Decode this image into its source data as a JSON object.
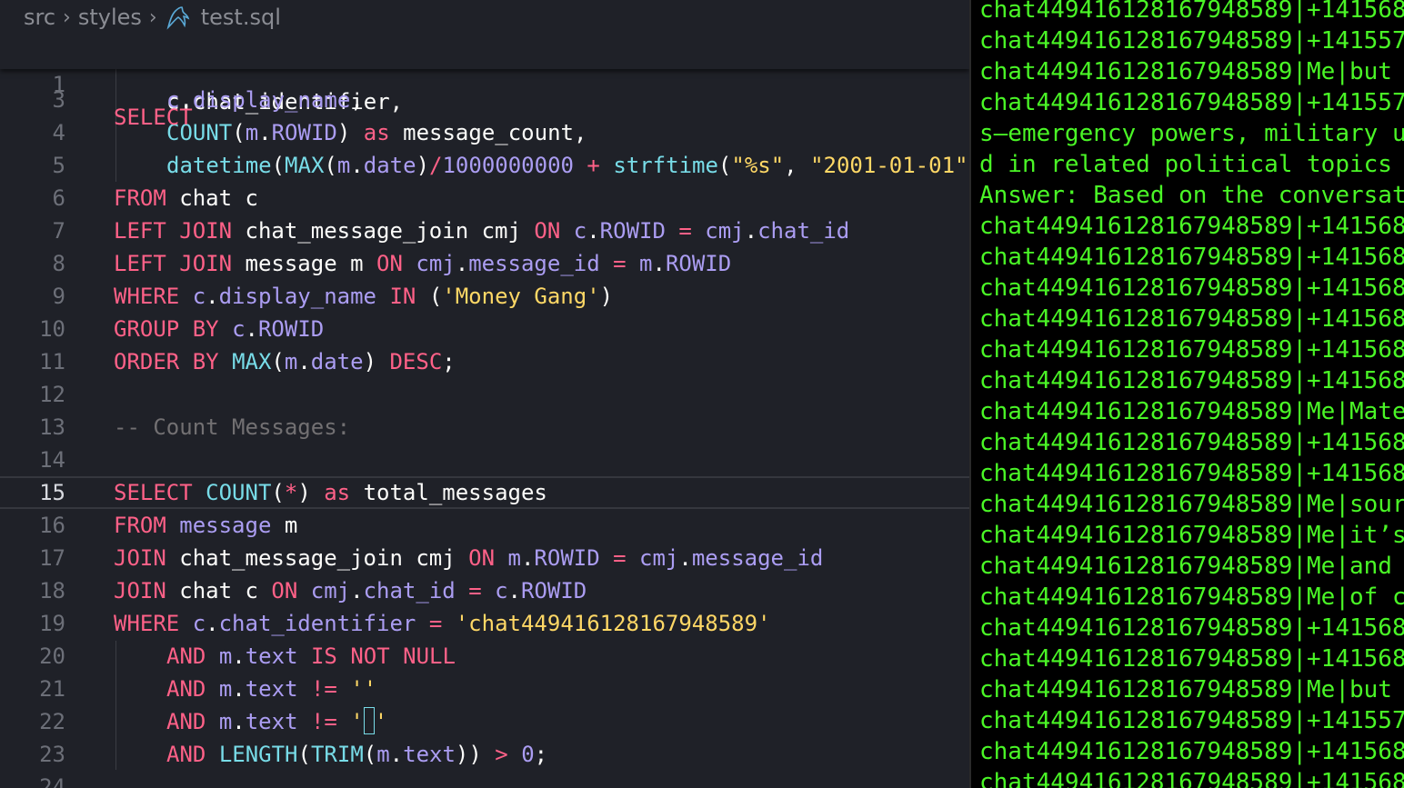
{
  "breadcrumb": {
    "items": [
      "src",
      "styles",
      "test.sql"
    ],
    "file_icon": "mysql-dolphin-icon"
  },
  "editor": {
    "sticky_line": {
      "number": "1",
      "text": "SELECT"
    },
    "partial_line_2": "c.chat_identifier,",
    "lines": [
      {
        "n": "3",
        "text": "c.display_name,"
      },
      {
        "n": "4",
        "text": "COUNT(m.ROWID) as message_count,"
      },
      {
        "n": "5",
        "text": "datetime(MAX(m.date)/1000000000 + strftime(\"%s\", \"2001-01-01\""
      },
      {
        "n": "6",
        "text": "FROM chat c"
      },
      {
        "n": "7",
        "text": "LEFT JOIN chat_message_join cmj ON c.ROWID = cmj.chat_id"
      },
      {
        "n": "8",
        "text": "LEFT JOIN message m ON cmj.message_id = m.ROWID"
      },
      {
        "n": "9",
        "text": "WHERE c.display_name IN ('Money Gang')"
      },
      {
        "n": "10",
        "text": "GROUP BY c.ROWID"
      },
      {
        "n": "11",
        "text": "ORDER BY MAX(m.date) DESC;"
      },
      {
        "n": "12",
        "text": ""
      },
      {
        "n": "13",
        "text": "-- Count Messages:"
      },
      {
        "n": "14",
        "text": ""
      },
      {
        "n": "15",
        "text": "SELECT COUNT(*) as total_messages"
      },
      {
        "n": "16",
        "text": "FROM message m"
      },
      {
        "n": "17",
        "text": "JOIN chat_message_join cmj ON m.ROWID = cmj.message_id"
      },
      {
        "n": "18",
        "text": "JOIN chat c ON cmj.chat_id = c.ROWID"
      },
      {
        "n": "19",
        "text": "WHERE c.chat_identifier = 'chat449416128167948589'"
      },
      {
        "n": "20",
        "text": "AND m.text IS NOT NULL"
      },
      {
        "n": "21",
        "text": "AND m.text != ''"
      },
      {
        "n": "22",
        "text": "AND m.text != '￼'"
      },
      {
        "n": "23",
        "text": "AND LENGTH(TRIM(m.text)) > 0;"
      },
      {
        "n": "24",
        "text": ""
      }
    ],
    "active_line": "15"
  },
  "terminal": {
    "lines": [
      "chat449416128167948589|+141568",
      "chat449416128167948589|+141557",
      "chat449416128167948589|Me|but",
      "chat449416128167948589|+141557",
      "s—emergency powers, military u",
      "d in related political topics",
      "Answer: Based on the conversat",
      "chat449416128167948589|+141568",
      "chat449416128167948589|+141568",
      "chat449416128167948589|+141568",
      "chat449416128167948589|+141568",
      "chat449416128167948589|+141568",
      "chat449416128167948589|+141568",
      "chat449416128167948589|Me|Mate",
      "chat449416128167948589|+141568",
      "chat449416128167948589|+141568",
      "chat449416128167948589|Me|sour",
      "chat449416128167948589|Me|it’s",
      "chat449416128167948589|Me|and",
      "chat449416128167948589|Me|of c",
      "chat449416128167948589|+141568",
      "chat449416128167948589|+141568",
      "chat449416128167948589|Me|but",
      "chat449416128167948589|+141557",
      "chat449416128167948589|+141568",
      "chat449416128167948589|+141568"
    ]
  }
}
